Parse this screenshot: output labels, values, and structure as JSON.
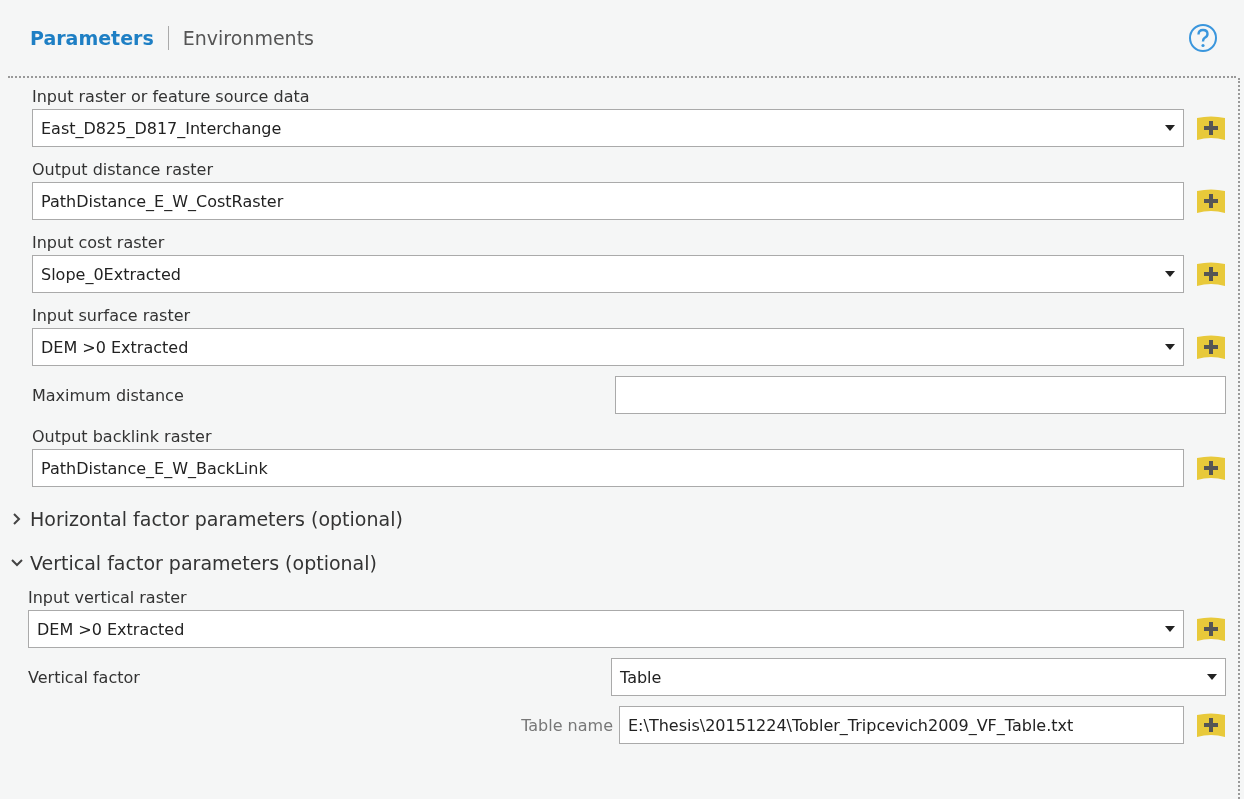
{
  "tabs": [
    {
      "label": "Parameters",
      "selected": true
    },
    {
      "label": "Environments",
      "selected": false
    }
  ],
  "parameters": [
    {
      "kind": "stacked",
      "label": "Input raster or feature source data",
      "value": "East_D825_D817_Interchange",
      "dropdown": true,
      "browse": true
    },
    {
      "kind": "stacked",
      "label": "Output distance raster",
      "value": "PathDistance_E_W_CostRaster",
      "dropdown": false,
      "browse": true
    },
    {
      "kind": "stacked",
      "label": "Input cost raster",
      "value": "Slope_0Extracted",
      "dropdown": true,
      "browse": true
    },
    {
      "kind": "stacked",
      "label": "Input surface raster",
      "value": "DEM >0 Extracted",
      "dropdown": true,
      "browse": true
    },
    {
      "kind": "inline",
      "label": "Maximum distance",
      "dropdown": false,
      "browse": false
    },
    {
      "kind": "stacked",
      "label": "Output backlink raster",
      "value": "PathDistance_E_W_BackLink",
      "dropdown": false,
      "browse": true
    }
  ],
  "sections": [
    {
      "title": "Horizontal factor parameters (optional)",
      "expanded": false
    },
    {
      "title": "Vertical factor parameters (optional)",
      "expanded": true,
      "parameters": [
        {
          "kind": "stacked",
          "label": "Input vertical raster",
          "value": "DEM >0 Extracted",
          "dropdown": true,
          "browse": true
        },
        {
          "kind": "inline",
          "label": "Vertical factor",
          "value": "Table",
          "dropdown": true,
          "browse": false
        },
        {
          "kind": "sub",
          "label": "Table name",
          "value": "E:\\Thesis\\20151224\\Tobler_Tripcevich2009_VF_Table.txt",
          "dropdown": false,
          "browse": true
        }
      ]
    }
  ]
}
